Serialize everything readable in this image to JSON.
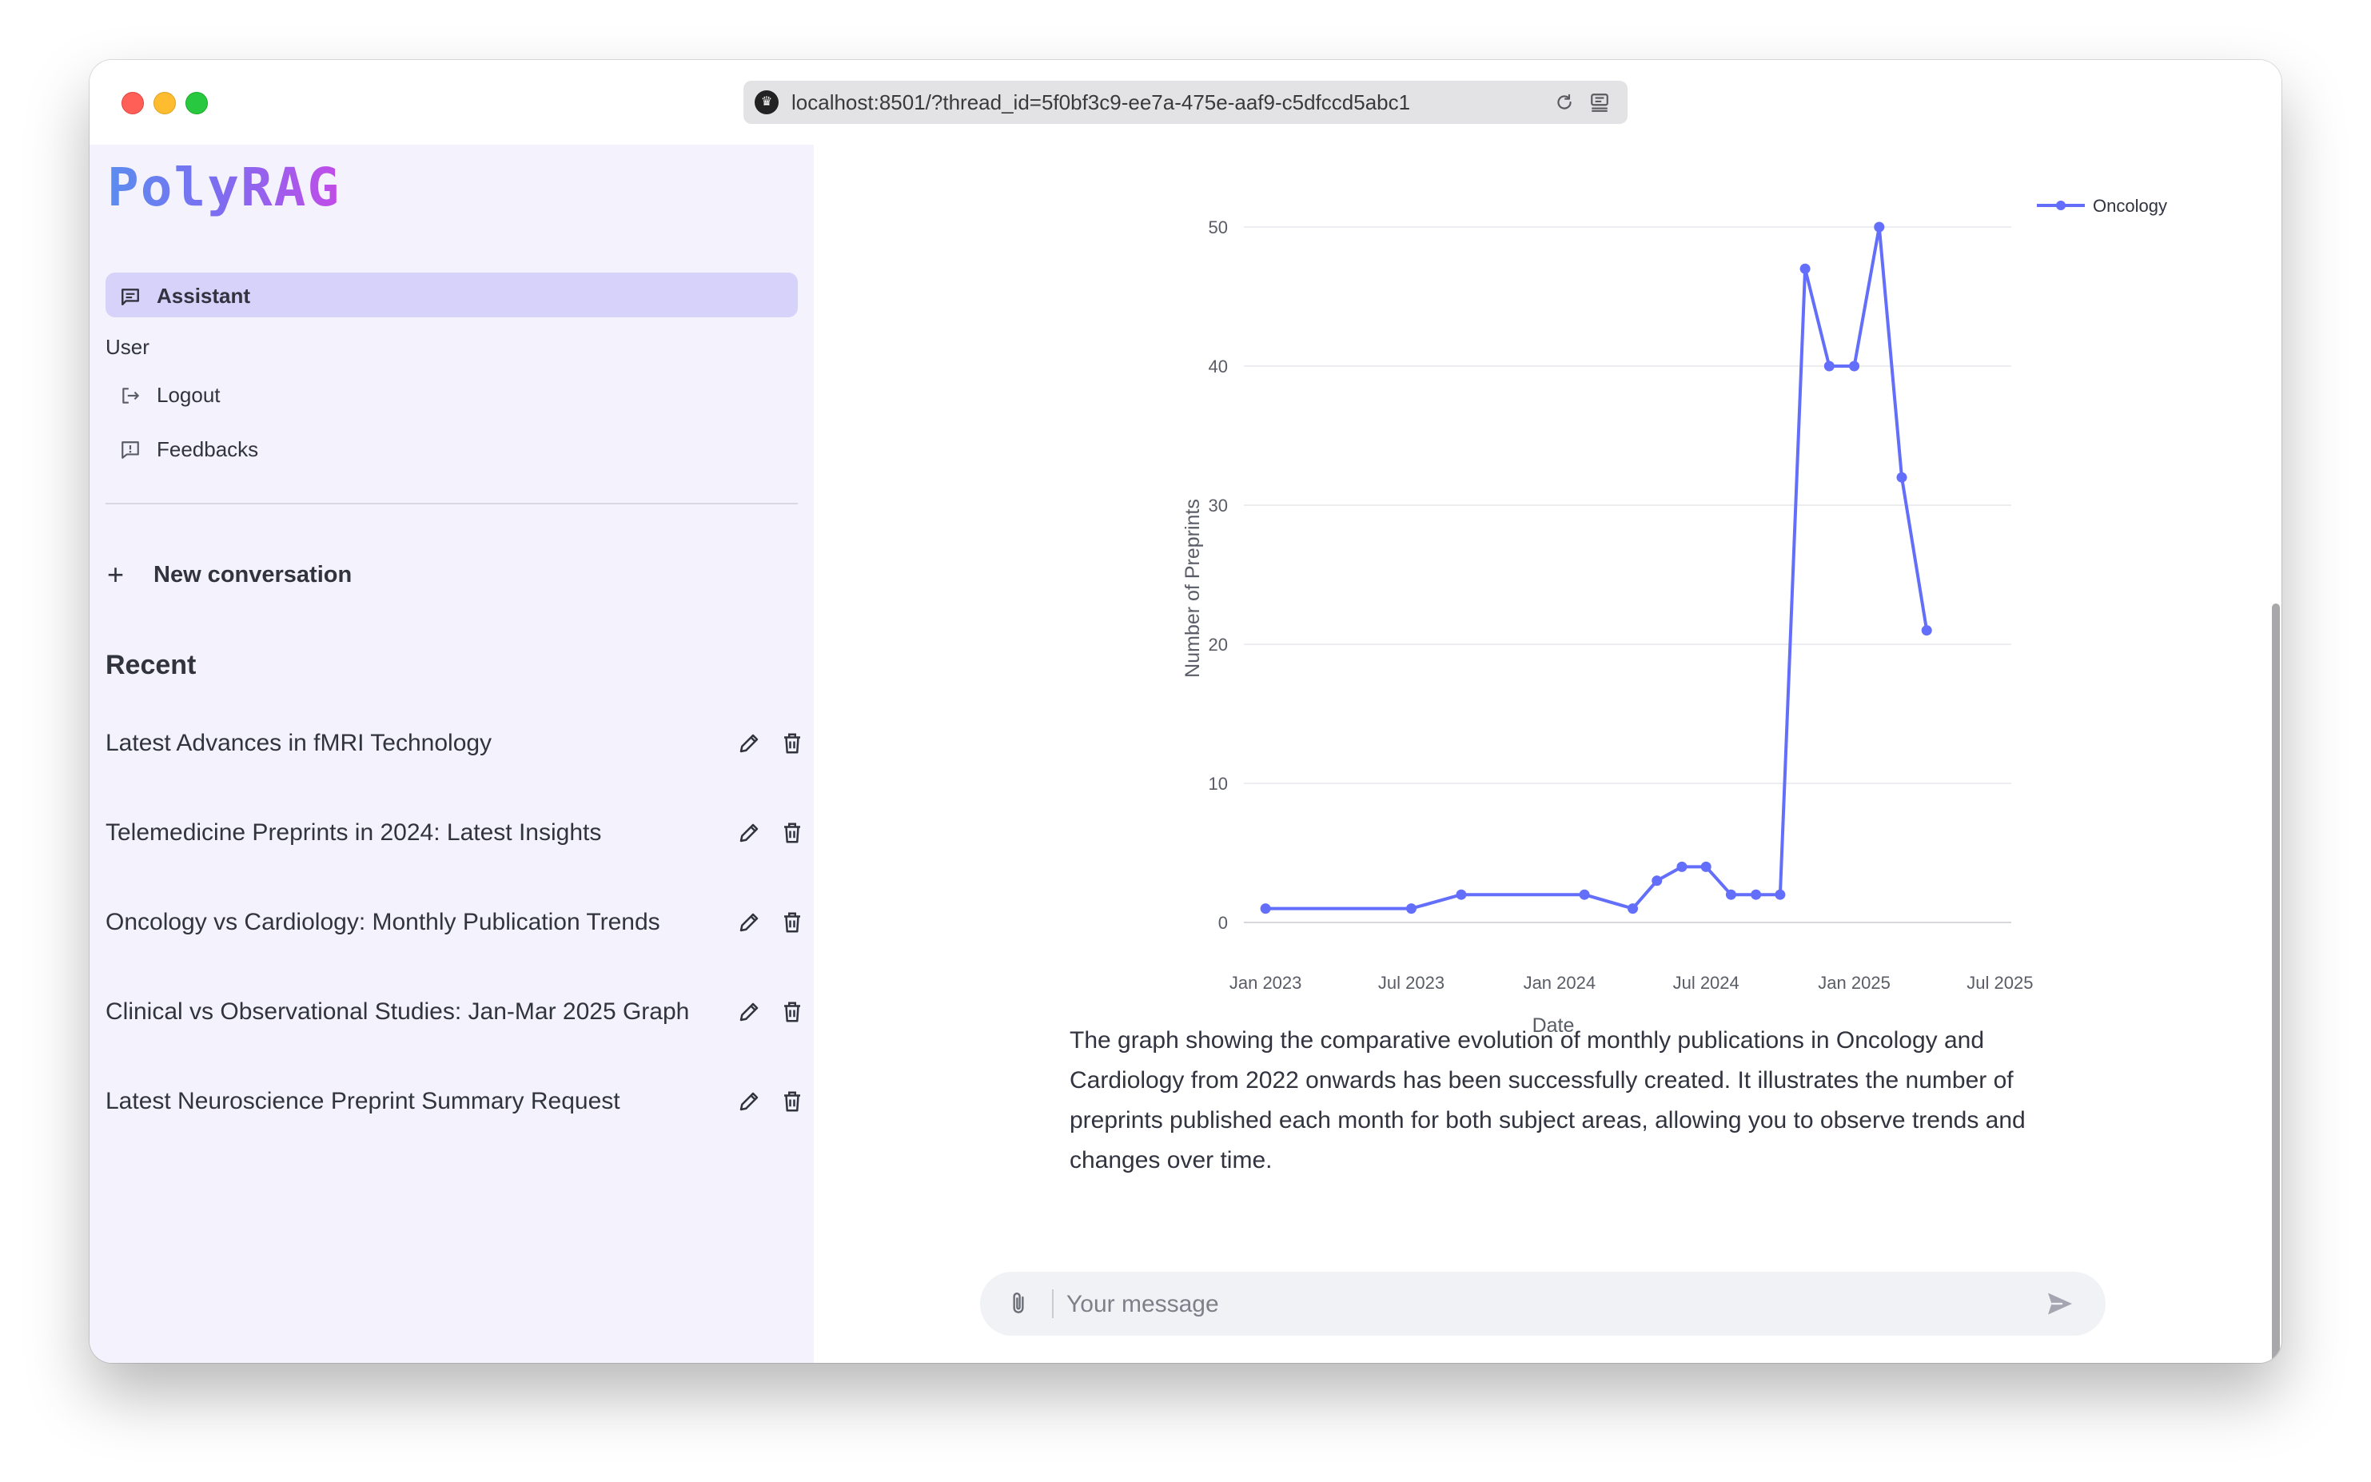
{
  "browser": {
    "url": "localhost:8501/?thread_id=5f0bf3c9-ee7a-475e-aaf9-c5dfccd5abc1"
  },
  "sidebar": {
    "logo": "PolyRAG",
    "nav": {
      "assistant_label": "Assistant",
      "user_section_label": "User",
      "logout_label": "Logout",
      "feedbacks_label": "Feedbacks"
    },
    "new_conversation_label": "New conversation",
    "recent_title": "Recent",
    "conversations": [
      {
        "title": "Latest Advances in fMRI Technology"
      },
      {
        "title": "Telemedicine Preprints in 2024: Latest Insights"
      },
      {
        "title": "Oncology vs Cardiology: Monthly Publication Trends"
      },
      {
        "title": "Clinical vs Observational Studies: Jan-Mar 2025 Graph"
      },
      {
        "title": "Latest Neuroscience Preprint Summary Request"
      }
    ]
  },
  "chart_data": {
    "type": "line",
    "title": "",
    "xlabel": "Date",
    "ylabel": "Number of Preprints",
    "x_tick_labels": [
      "Jan 2023",
      "Jul 2023",
      "Jan 2024",
      "Jul 2024",
      "Jan 2025",
      "Jul 2025"
    ],
    "y_ticks": [
      0,
      10,
      20,
      30,
      40,
      50
    ],
    "ylim": [
      0,
      50
    ],
    "xlim": [
      "2022-12-15",
      "2025-07-15"
    ],
    "grid": true,
    "legend_position": "top-right",
    "series": [
      {
        "name": "Oncology",
        "color": "#636efa",
        "points": [
          {
            "x": "2023-01-01",
            "y": 1
          },
          {
            "x": "2023-07-01",
            "y": 1
          },
          {
            "x": "2023-09-01",
            "y": 2
          },
          {
            "x": "2024-02-01",
            "y": 2
          },
          {
            "x": "2024-04-01",
            "y": 1
          },
          {
            "x": "2024-05-01",
            "y": 3
          },
          {
            "x": "2024-06-01",
            "y": 4
          },
          {
            "x": "2024-07-01",
            "y": 4
          },
          {
            "x": "2024-08-01",
            "y": 2
          },
          {
            "x": "2024-09-01",
            "y": 2
          },
          {
            "x": "2024-10-01",
            "y": 2
          },
          {
            "x": "2024-11-01",
            "y": 47
          },
          {
            "x": "2024-12-01",
            "y": 40
          },
          {
            "x": "2025-01-01",
            "y": 40
          },
          {
            "x": "2025-02-01",
            "y": 50
          },
          {
            "x": "2025-03-01",
            "y": 32
          },
          {
            "x": "2025-04-01",
            "y": 21
          }
        ]
      }
    ]
  },
  "message": {
    "text": "The graph showing the comparative evolution of monthly publications in Oncology and Cardiology from 2022 onwards has been successfully created. It illustrates the number of preprints published each month for both subject areas, allowing you to observe trends and changes over time."
  },
  "input": {
    "placeholder": "Your message"
  },
  "colors": {
    "accent": "#636efa",
    "sidebar_bg": "#f4f3fd",
    "nav_active_bg": "#d6d2fa"
  }
}
